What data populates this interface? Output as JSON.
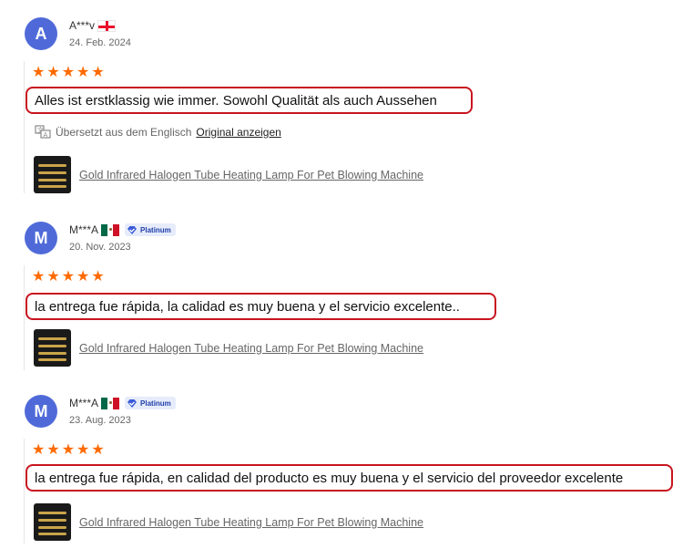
{
  "reviews": [
    {
      "avatar_letter": "A",
      "name": "A***v",
      "flag": "georgia-flag-icon",
      "badge": "",
      "date": "24. Feb. 2024",
      "rating": 5,
      "text": "Alles ist erstklassig wie immer. Sowohl Qualität als auch Aussehen",
      "translated_label": "Übersetzt aus dem Englisch",
      "original_link": "Original anzeigen",
      "product": "Gold Infrared Halogen Tube Heating Lamp For Pet Blowing Machine"
    },
    {
      "avatar_letter": "M",
      "name": "M***A",
      "flag": "mexico-flag-icon",
      "badge": "Platinum",
      "date": "20. Nov. 2023",
      "rating": 5,
      "text": "la entrega fue rápida, la calidad es muy buena y el servicio excelente..",
      "product": "Gold Infrared Halogen Tube Heating Lamp For Pet Blowing Machine"
    },
    {
      "avatar_letter": "M",
      "name": "M***A",
      "flag": "mexico-flag-icon",
      "badge": "Platinum",
      "date": "23. Aug. 2023",
      "rating": 5,
      "text": "la entrega fue rápida, en calidad del producto es muy buena y el servicio del proveedor excelente",
      "product": "Gold Infrared Halogen Tube Heating Lamp For Pet Blowing Machine"
    }
  ],
  "colors": {
    "avatar": "#4f6ad8",
    "star": "#ff6a00",
    "highlight_border": "#c8141e",
    "badge_bg": "#e7ecfb",
    "badge_text": "#1f3ea8"
  }
}
